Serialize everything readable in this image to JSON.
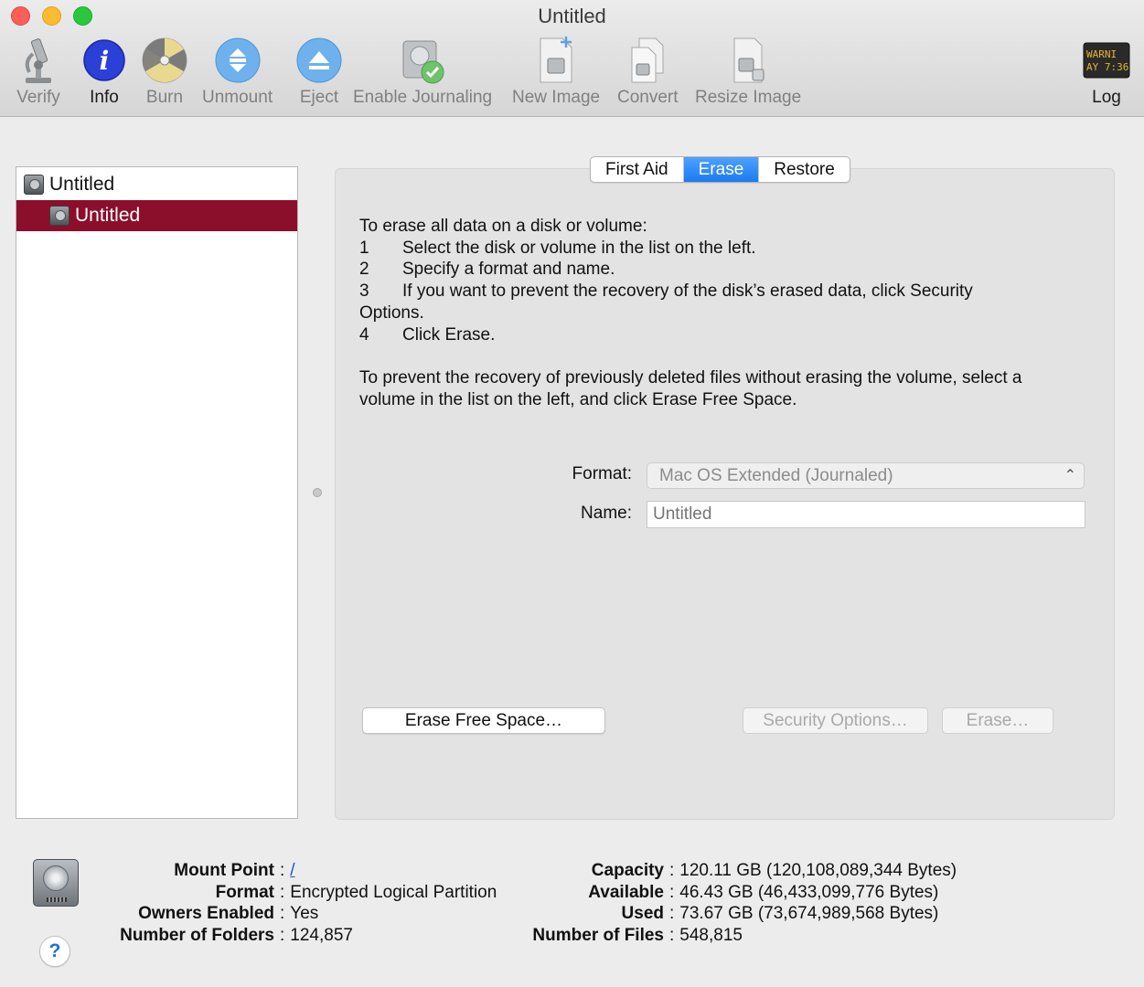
{
  "window": {
    "title": "Untitled"
  },
  "toolbar": {
    "items": [
      {
        "label": "Verify",
        "icon": "microscope-icon",
        "active": false
      },
      {
        "label": "Info",
        "icon": "info-icon",
        "active": true
      },
      {
        "label": "Burn",
        "icon": "burn-icon",
        "active": false
      },
      {
        "label": "Unmount",
        "icon": "unmount-icon",
        "active": false
      },
      {
        "label": "Eject",
        "icon": "eject-icon",
        "active": false
      },
      {
        "label": "Enable Journaling",
        "icon": "journaling-disk-icon",
        "active": false
      },
      {
        "label": "New Image",
        "icon": "new-image-icon",
        "active": false
      },
      {
        "label": "Convert",
        "icon": "convert-icon",
        "active": false
      },
      {
        "label": "Resize Image",
        "icon": "resize-image-icon",
        "active": false
      }
    ],
    "log": {
      "label": "Log",
      "icon": "log-console-icon",
      "screen_text_1": "WARNI",
      "screen_text_2": "AY 7:36"
    }
  },
  "sidebar": {
    "items": [
      {
        "label": "Untitled",
        "level": "disk",
        "selected": false
      },
      {
        "label": "Untitled",
        "level": "volume",
        "selected": true
      }
    ]
  },
  "tabs": [
    {
      "label": "First Aid",
      "active": false
    },
    {
      "label": "Erase",
      "active": true
    },
    {
      "label": "Restore",
      "active": false
    }
  ],
  "erase": {
    "intro": "To erase all data on a disk or volume:",
    "steps": [
      {
        "num": "1",
        "text": "Select the disk or volume in the list on the left."
      },
      {
        "num": "2",
        "text": "Specify a format and name."
      },
      {
        "num": "3",
        "text": "If you want to prevent the recovery of the disk’s erased data, click Security",
        "continuation": "Options."
      },
      {
        "num": "4",
        "text": "Click Erase."
      }
    ],
    "free_space_note": "To prevent the recovery of previously deleted files without erasing the volume, select a volume in the list on the left, and click Erase Free Space.",
    "format_label": "Format:",
    "format_value": "Mac OS Extended (Journaled)",
    "name_label": "Name:",
    "name_placeholder": "Untitled",
    "buttons": {
      "erase_free_space": "Erase Free Space…",
      "security_options": "Security Options…",
      "erase": "Erase…"
    }
  },
  "info": {
    "left": [
      {
        "key": "Mount Point",
        "value": "/",
        "link": true
      },
      {
        "key": "Format",
        "value": "Encrypted Logical Partition"
      },
      {
        "key": "Owners Enabled",
        "value": "Yes"
      },
      {
        "key": "Number of Folders",
        "value": "124,857"
      }
    ],
    "right": [
      {
        "key": "Capacity",
        "value": "120.11 GB (120,108,089,344 Bytes)"
      },
      {
        "key": "Available",
        "value": "46.43 GB (46,433,099,776 Bytes)"
      },
      {
        "key": "Used",
        "value": "73.67 GB (73,674,989,568 Bytes)"
      },
      {
        "key": "Number of Files",
        "value": "548,815"
      }
    ],
    "help_label": "?"
  }
}
